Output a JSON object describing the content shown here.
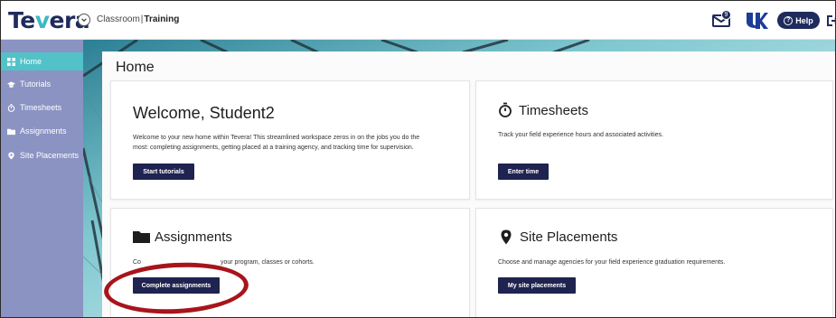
{
  "header": {
    "logo": {
      "prefix": "Te",
      "accent": "v",
      "suffix": "era"
    },
    "breadcrumb": {
      "part1": "Classroom",
      "separator": "|",
      "part2": "Training"
    },
    "mail_count": "9",
    "help_label": "Help"
  },
  "sidebar": {
    "items": [
      {
        "label": "Home",
        "icon": "grid-icon",
        "active": true
      },
      {
        "label": "Tutorials",
        "icon": "graduation-cap-icon"
      },
      {
        "label": "Timesheets",
        "icon": "stopwatch-icon"
      },
      {
        "label": "Assignments",
        "icon": "folder-icon"
      },
      {
        "label": "Site Placements",
        "icon": "map-pin-icon"
      }
    ]
  },
  "main": {
    "page_title": "Home",
    "welcome": {
      "title": "Welcome, Student2",
      "description_line1": "Welcome to your new home within Tevera! This streamlined workspace zeros in on the jobs you do the",
      "description_line2": "most: completing assignments, getting placed at a training agency, and tracking time for supervision.",
      "button": "Start tutorials"
    },
    "timesheets": {
      "title": "Timesheets",
      "description": "Track your field experience hours and associated activities.",
      "button": "Enter time"
    },
    "assignments": {
      "title": "Assignments",
      "description_visible_start": "Co",
      "description_visible_end": "your program, classes or cohorts.",
      "button": "Complete assignments"
    },
    "site_placements": {
      "title": "Site Placements",
      "description": "Choose and manage agencies for your field experience graduation requirements.",
      "button": "My site placements"
    }
  },
  "colors": {
    "brand_navy": "#1f2b5c",
    "brand_teal": "#3fb8c3",
    "sidebar_bg": "#8a93c2",
    "sidebar_active": "#52c2c8",
    "button_bg": "#1f2350",
    "highlight": "#a8141b"
  }
}
